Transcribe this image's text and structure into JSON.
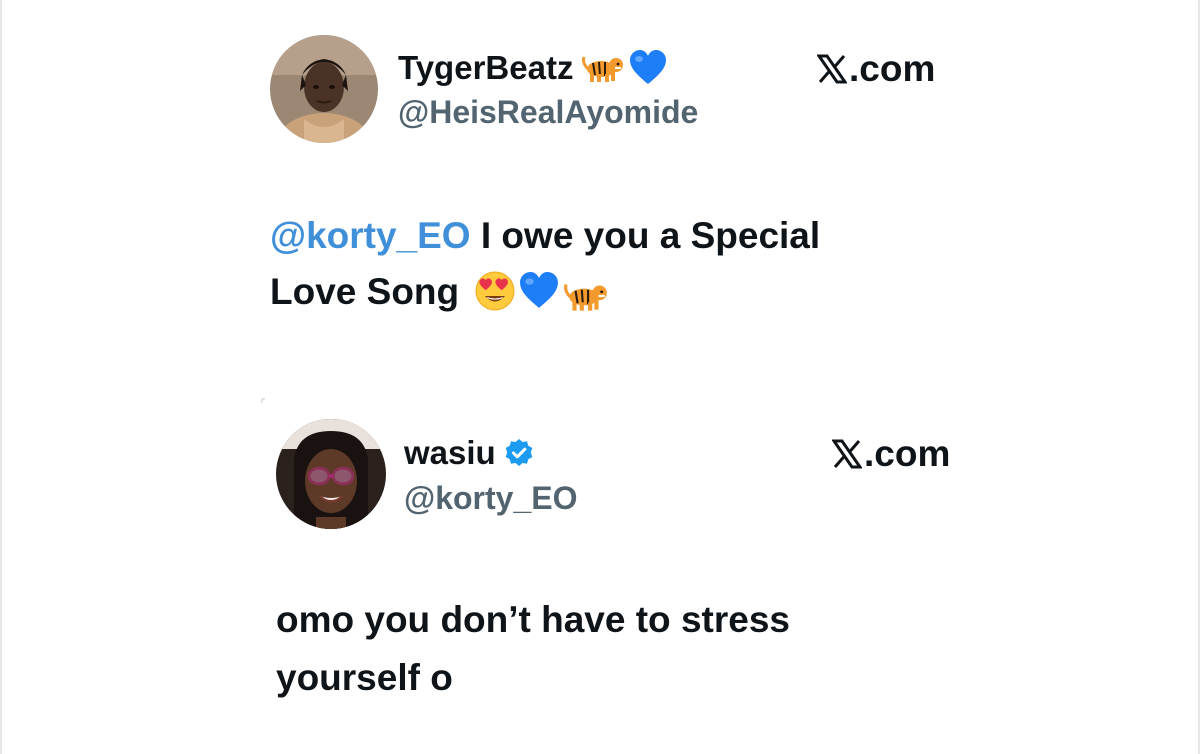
{
  "tweets": [
    {
      "display_name": "TygerBeatz",
      "name_icons": [
        "tiger-icon",
        "blue-heart-icon"
      ],
      "handle": "@HeisRealAyomide",
      "site_label": ".com",
      "text": {
        "mention": "@korty_EO",
        "line1_rest": " I owe you a Special",
        "line2": "Love Song",
        "emojis": [
          "heart-eyes-emoji",
          "blue-heart-emoji",
          "tiger-emoji"
        ]
      }
    },
    {
      "display_name": "wasiu",
      "name_icons": [
        "verified-badge-icon"
      ],
      "handle": "@korty_EO",
      "site_label": ".com",
      "text": {
        "line1": "omo you don’t have to stress",
        "line2": "yourself o"
      }
    }
  ],
  "colors": {
    "text": "#0f1419",
    "handle": "#536471",
    "mention": "#3f8fd9",
    "verified": "#1d9bf0",
    "heart": "#1e7ef7"
  }
}
